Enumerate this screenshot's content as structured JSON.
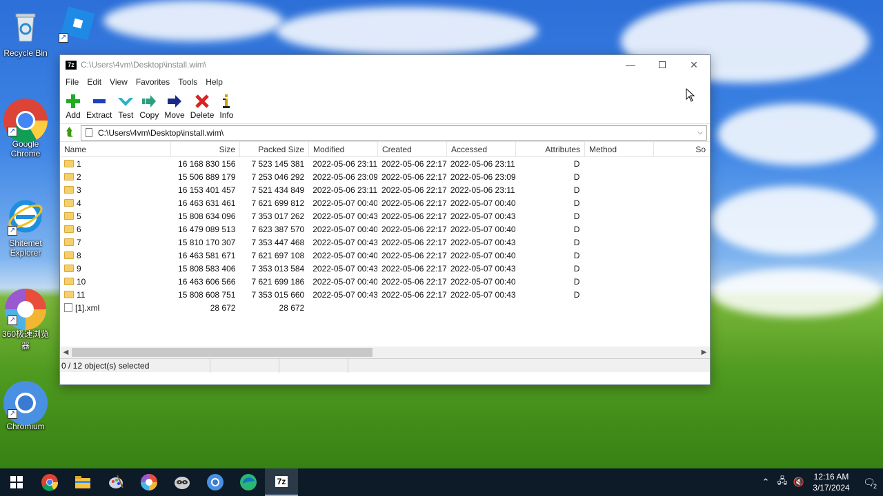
{
  "desktop": {
    "icons": [
      {
        "label": "Recycle Bin"
      },
      {
        "label": "Google Chrome"
      },
      {
        "label": "Shitemet Explorer"
      },
      {
        "label": "360极速浏览器"
      },
      {
        "label": "Chromium"
      }
    ]
  },
  "window": {
    "title": "C:\\Users\\4vm\\Desktop\\install.wim\\",
    "title_icon": "7z",
    "menu": [
      "File",
      "Edit",
      "View",
      "Favorites",
      "Tools",
      "Help"
    ],
    "toolbar": [
      {
        "label": "Add",
        "icon": "plus-icon",
        "color": "#22aa22"
      },
      {
        "label": "Extract",
        "icon": "minus-icon",
        "color": "#1a3fbf"
      },
      {
        "label": "Test",
        "icon": "check-icon",
        "color": "#2ab0c8"
      },
      {
        "label": "Copy",
        "icon": "copy-arrow-icon",
        "color": "#2aa080"
      },
      {
        "label": "Move",
        "icon": "move-arrow-icon",
        "color": "#1a2a8a"
      },
      {
        "label": "Delete",
        "icon": "delete-x-icon",
        "color": "#dd2020"
      },
      {
        "label": "Info",
        "icon": "info-icon",
        "color": "#c8a800"
      }
    ],
    "address": "C:\\Users\\4vm\\Desktop\\install.wim\\",
    "columns": [
      "Name",
      "Size",
      "Packed Size",
      "Modified",
      "Created",
      "Accessed",
      "Attributes",
      "Method",
      "So"
    ],
    "rows": [
      {
        "name": "1",
        "size": "16 168 830 156",
        "packed": "7 523 145 381",
        "modified": "2022-05-06 23:11",
        "created": "2022-05-06 22:17",
        "accessed": "2022-05-06 23:11",
        "attr": "D",
        "type": "folder"
      },
      {
        "name": "2",
        "size": "15 506 889 179",
        "packed": "7 253 046 292",
        "modified": "2022-05-06 23:09",
        "created": "2022-05-06 22:17",
        "accessed": "2022-05-06 23:09",
        "attr": "D",
        "type": "folder"
      },
      {
        "name": "3",
        "size": "16 153 401 457",
        "packed": "7 521 434 849",
        "modified": "2022-05-06 23:11",
        "created": "2022-05-06 22:17",
        "accessed": "2022-05-06 23:11",
        "attr": "D",
        "type": "folder"
      },
      {
        "name": "4",
        "size": "16 463 631 461",
        "packed": "7 621 699 812",
        "modified": "2022-05-07 00:40",
        "created": "2022-05-06 22:17",
        "accessed": "2022-05-07 00:40",
        "attr": "D",
        "type": "folder"
      },
      {
        "name": "5",
        "size": "15 808 634 096",
        "packed": "7 353 017 262",
        "modified": "2022-05-07 00:43",
        "created": "2022-05-06 22:17",
        "accessed": "2022-05-07 00:43",
        "attr": "D",
        "type": "folder"
      },
      {
        "name": "6",
        "size": "16 479 089 513",
        "packed": "7 623 387 570",
        "modified": "2022-05-07 00:40",
        "created": "2022-05-06 22:17",
        "accessed": "2022-05-07 00:40",
        "attr": "D",
        "type": "folder"
      },
      {
        "name": "7",
        "size": "15 810 170 307",
        "packed": "7 353 447 468",
        "modified": "2022-05-07 00:43",
        "created": "2022-05-06 22:17",
        "accessed": "2022-05-07 00:43",
        "attr": "D",
        "type": "folder"
      },
      {
        "name": "8",
        "size": "16 463 581 671",
        "packed": "7 621 697 108",
        "modified": "2022-05-07 00:40",
        "created": "2022-05-06 22:17",
        "accessed": "2022-05-07 00:40",
        "attr": "D",
        "type": "folder"
      },
      {
        "name": "9",
        "size": "15 808 583 406",
        "packed": "7 353 013 584",
        "modified": "2022-05-07 00:43",
        "created": "2022-05-06 22:17",
        "accessed": "2022-05-07 00:43",
        "attr": "D",
        "type": "folder"
      },
      {
        "name": "10",
        "size": "16 463 606 566",
        "packed": "7 621 699 186",
        "modified": "2022-05-07 00:40",
        "created": "2022-05-06 22:17",
        "accessed": "2022-05-07 00:40",
        "attr": "D",
        "type": "folder"
      },
      {
        "name": "11",
        "size": "15 808 608 751",
        "packed": "7 353 015 660",
        "modified": "2022-05-07 00:43",
        "created": "2022-05-06 22:17",
        "accessed": "2022-05-07 00:43",
        "attr": "D",
        "type": "folder"
      },
      {
        "name": "[1].xml",
        "size": "28 672",
        "packed": "28 672",
        "modified": "",
        "created": "",
        "accessed": "",
        "attr": "",
        "type": "file"
      }
    ],
    "status": "0 / 12 object(s) selected"
  },
  "taskbar": {
    "items": [
      "windows-start-icon",
      "chrome-icon",
      "file-explorer-icon",
      "paint-icon",
      "360-browser-icon",
      "raccoon-app-icon",
      "chromium-icon",
      "edge-icon",
      "7zip-icon"
    ],
    "clock_time": "12:16 AM",
    "clock_date": "3/17/2024",
    "notification_count": "2"
  }
}
